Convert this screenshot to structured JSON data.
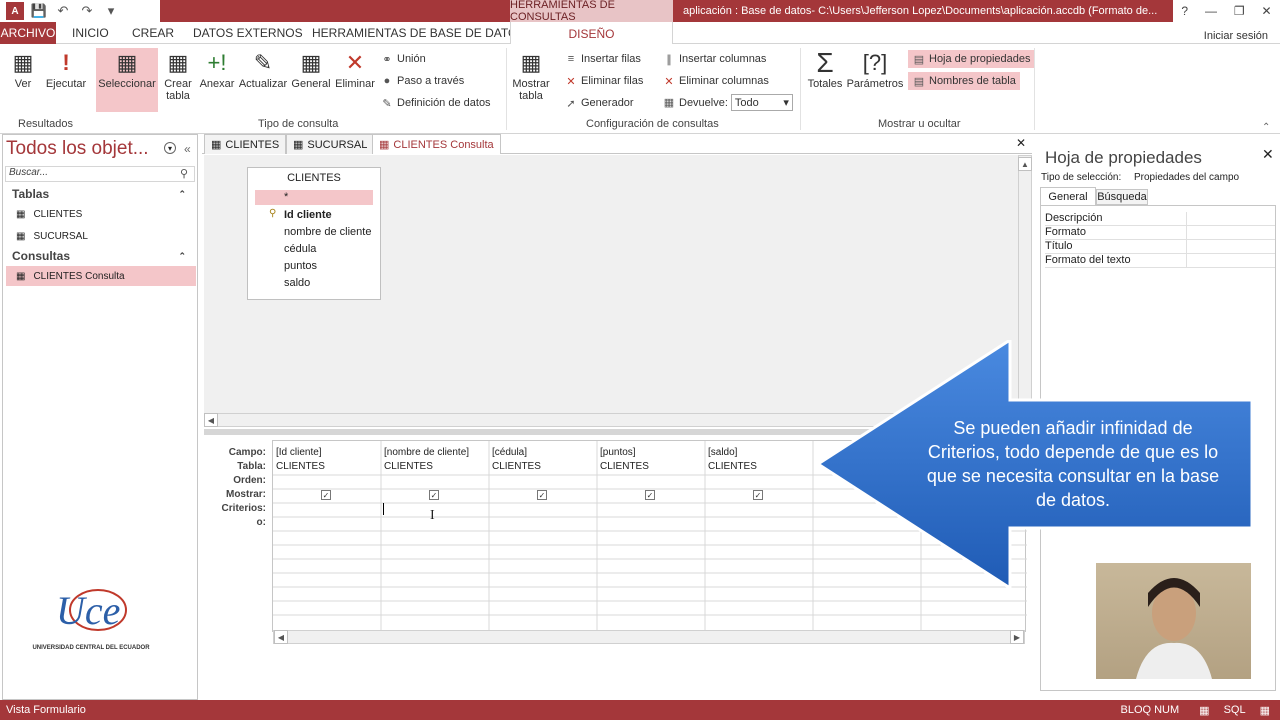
{
  "titlebar": {
    "context_tab": "HERRAMIENTAS DE CONSULTAS",
    "document_title": "aplicación : Base de datos- C:\\Users\\Jefferson Lopez\\Documents\\aplicación.accdb (Formato de...",
    "help": "?",
    "minimize": "—",
    "restore": "❐",
    "close": "✕"
  },
  "ribbon_tabs": {
    "archivo": "ARCHIVO",
    "inicio": "INICIO",
    "crear": "CREAR",
    "datos_externos": "DATOS EXTERNOS",
    "herramientas": "HERRAMIENTAS DE BASE DE DATOS",
    "diseno": "DISEÑO",
    "signin": "Iniciar sesión"
  },
  "ribbon": {
    "ver": "Ver",
    "ejecutar": "Ejecutar",
    "seleccionar": "Seleccionar",
    "crear_tabla": "Crear tabla",
    "anexar": "Anexar",
    "actualizar": "Actualizar",
    "general": "General",
    "eliminar": "Eliminar",
    "union": "Unión",
    "paso": "Paso a través",
    "definicion": "Definición de datos",
    "mostrar_tabla": "Mostrar tabla",
    "insertar_filas": "Insertar filas",
    "eliminar_filas": "Eliminar filas",
    "generador": "Generador",
    "insertar_columnas": "Insertar columnas",
    "eliminar_columnas": "Eliminar columnas",
    "devuelve": "Devuelve:",
    "devuelve_value": "Todo",
    "totales": "Totales",
    "parametros": "Parámetros",
    "hoja_propiedades": "Hoja de propiedades",
    "nombres_tabla": "Nombres de tabla",
    "grp_resultados": "Resultados",
    "grp_tipo": "Tipo de consulta",
    "grp_config": "Configuración de consultas",
    "grp_mostrar": "Mostrar u ocultar"
  },
  "nav": {
    "title": "Todos los objet...",
    "search_placeholder": "Buscar...",
    "group_tablas": "Tablas",
    "item_clientes": "CLIENTES",
    "item_sucursal": "SUCURSAL",
    "group_consultas": "Consultas",
    "item_consulta": "CLIENTES Consulta"
  },
  "doctabs": [
    "CLIENTES",
    "SUCURSAL",
    "CLIENTES Consulta"
  ],
  "tablebox": {
    "title": "CLIENTES",
    "fields": [
      "*",
      "Id cliente",
      "nombre de cliente",
      "cédula",
      "puntos",
      "saldo"
    ]
  },
  "grid": {
    "row_labels": [
      "Campo:",
      "Tabla:",
      "Orden:",
      "Mostrar:",
      "Criterios:",
      "o:"
    ],
    "columns": [
      {
        "campo": "[Id cliente]",
        "tabla": "CLIENTES"
      },
      {
        "campo": "[nombre de cliente]",
        "tabla": "CLIENTES"
      },
      {
        "campo": "[cédula]",
        "tabla": "CLIENTES"
      },
      {
        "campo": "[puntos]",
        "tabla": "CLIENTES"
      },
      {
        "campo": "[saldo]",
        "tabla": "CLIENTES"
      }
    ]
  },
  "props": {
    "title": "Hoja de propiedades",
    "selection_label": "Tipo de selección:",
    "selection_value": "Propiedades del campo",
    "tab_general": "General",
    "tab_busqueda": "Búsqueda",
    "rows": [
      "Descripción",
      "Formato",
      "Título",
      "Formato del texto"
    ]
  },
  "callout": {
    "text": "Se pueden añadir infinidad de Criterios, todo depende de que es lo que se necesita consultar en la base de datos."
  },
  "logo": {
    "text": "UNIVERSIDAD CENTRAL DEL ECUADOR"
  },
  "status": {
    "left": "Vista Formulario",
    "caps": "BLOQ NUM"
  },
  "colors": {
    "accent": "#a4373a",
    "selected": "#f4c6c9",
    "callout": "#2f6fd0"
  }
}
